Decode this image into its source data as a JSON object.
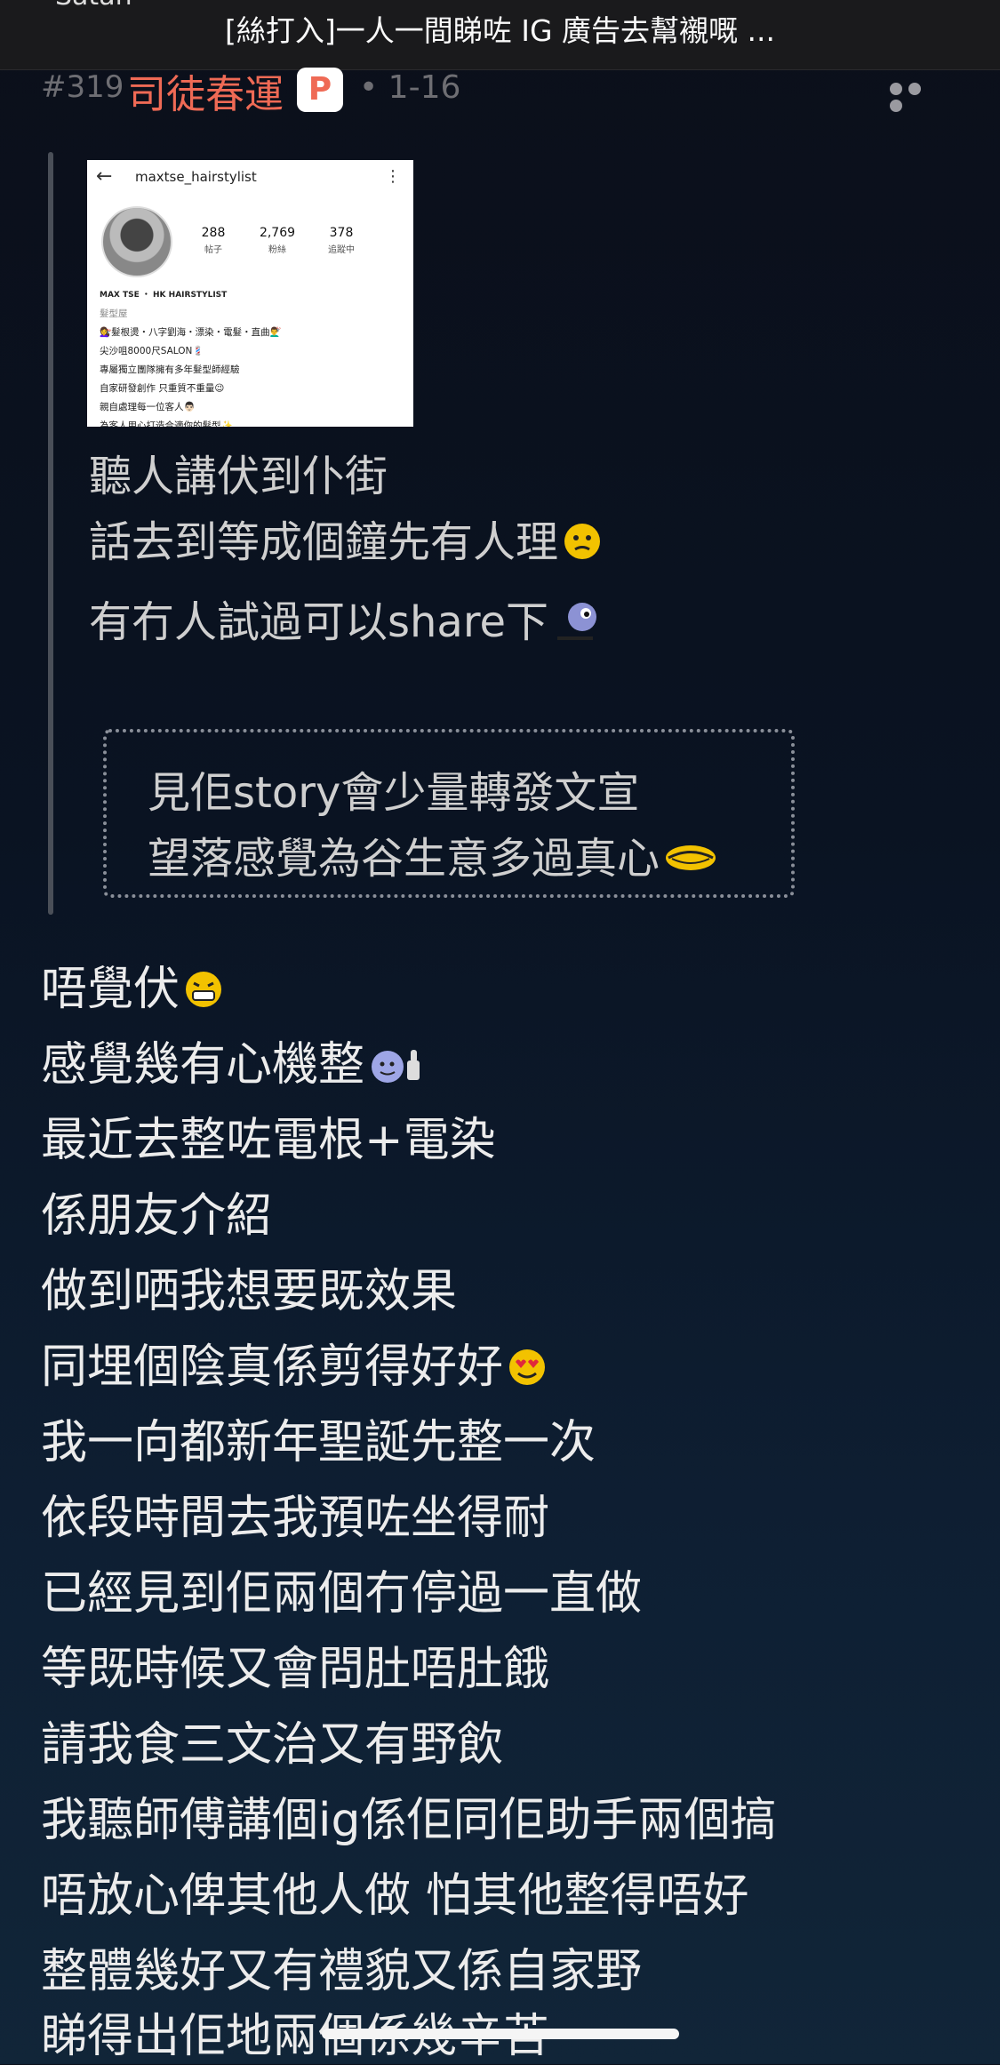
{
  "topbar": {
    "status_fragment": "Satan",
    "thread_title": "[絲打入]一人一間睇咗 IG 廣告去幫襯嘅 ..."
  },
  "post": {
    "number": "#319",
    "author": "司徒春運",
    "badge": "P",
    "date": "• 1-16",
    "more_icon": "more-dots-icon"
  },
  "quoted_image": {
    "handle": "maxtse_hairstylist",
    "stats": [
      {
        "value": "288",
        "label": "帖子"
      },
      {
        "value": "2,769",
        "label": "粉絲"
      },
      {
        "value": "378",
        "label": "追蹤中"
      }
    ],
    "bio_name": "MAX TSE ・ HK HAIRSTYLIST",
    "bio_category": "髮型屋",
    "bio_lines": [
      "💇‍♀️髮根燙・八字劉海・漂染・電髮・直曲💇‍♂️",
      "尖沙咀8000尺SALON💈",
      "專屬獨立團隊擁有多年髮型師經驗",
      "自家研發創作 只重質不重量😉",
      "親自處理每一位客人👨🏻",
      "為客人用心打造合適你的髮型✨"
    ]
  },
  "quote": {
    "lines": [
      "聽人講伏到仆街",
      "話去到等成個鐘先有人理",
      "有冇人試過可以share下"
    ],
    "nested": [
      "見佢story會少量轉發文宣",
      "望落感覺為谷生意多過真心"
    ]
  },
  "body_lines": [
    "唔覺伏",
    "感覺幾有心機整",
    "最近去整咗電根+電染",
    "係朋友介紹",
    "做到哂我想要既效果",
    "同埋個陰真係剪得好好",
    "我一向都新年聖誕先整一次",
    "依段時間去我預咗坐得耐",
    "已經見到佢兩個冇停過一直做",
    "等既時候又會問肚唔肚餓",
    "請我食三文治又有野飲",
    "我聽師傅講個ig係佢同佢助手兩個搞",
    "唔放心俾其他人做 怕其他整得唔好",
    "整體幾好又有禮貌又係自家野",
    "睇得出佢地兩個係幾辛苦"
  ]
}
